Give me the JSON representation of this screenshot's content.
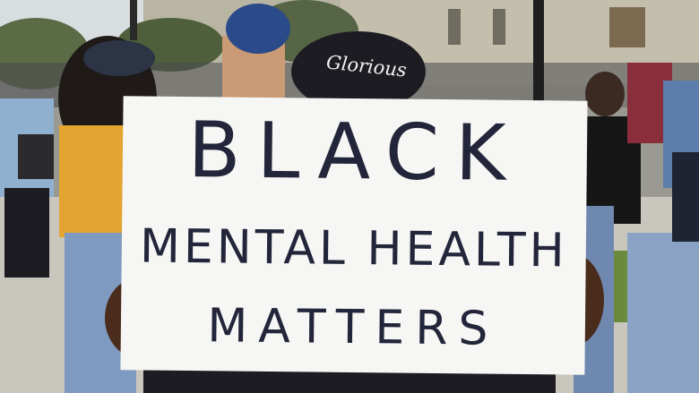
{
  "photo": {
    "sign": {
      "line1": "BLACK",
      "line2": "MENTAL HEALTH",
      "line3": "MATTERS"
    },
    "hat_text": "Glorious"
  }
}
